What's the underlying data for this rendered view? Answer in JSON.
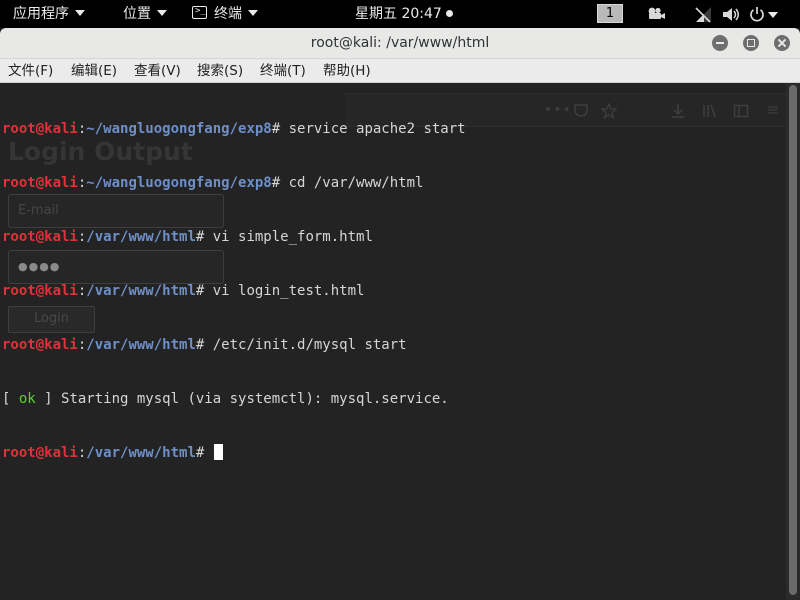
{
  "panel": {
    "apps_label": "应用程序",
    "places_label": "位置",
    "terminal_label": "终端",
    "clock": "星期五 20:47",
    "workspace": "1"
  },
  "window": {
    "title": "root@kali: /var/www/html"
  },
  "menu": {
    "items": [
      "文件(F)",
      "编辑(E)",
      "查看(V)",
      "搜索(S)",
      "终端(T)",
      "帮助(H)"
    ]
  },
  "terminal": {
    "lines": [
      {
        "user": "root@kali",
        "path": "~/wangluogongfang/exp8",
        "cmd": "service apache2 start"
      },
      {
        "user": "root@kali",
        "path": "~/wangluogongfang/exp8",
        "cmd": "cd /var/www/html"
      },
      {
        "user": "root@kali",
        "path": "/var/www/html",
        "cmd": "vi simple_form.html"
      },
      {
        "user": "root@kali",
        "path": "/var/www/html",
        "cmd": "vi login_test.html"
      },
      {
        "user": "root@kali",
        "path": "/var/www/html",
        "cmd": "/etc/init.d/mysql start"
      }
    ],
    "status_line": {
      "open": "[ ",
      "ok": "ok",
      "close": " ] ",
      "message": "Starting mysql (via systemctl): mysql.service."
    },
    "current_prompt": {
      "user": "root@kali",
      "path": "/var/www/html",
      "cmd": ""
    }
  },
  "background_page": {
    "heading": "Login Output",
    "email_placeholder": "E-mail",
    "password_mask": "●●●●",
    "login_button": "Login"
  },
  "colors": {
    "prompt_user": "#e0323a",
    "prompt_path": "#6f8fc8",
    "ok": "#5fcf34",
    "terminal_bg": "#232323"
  }
}
